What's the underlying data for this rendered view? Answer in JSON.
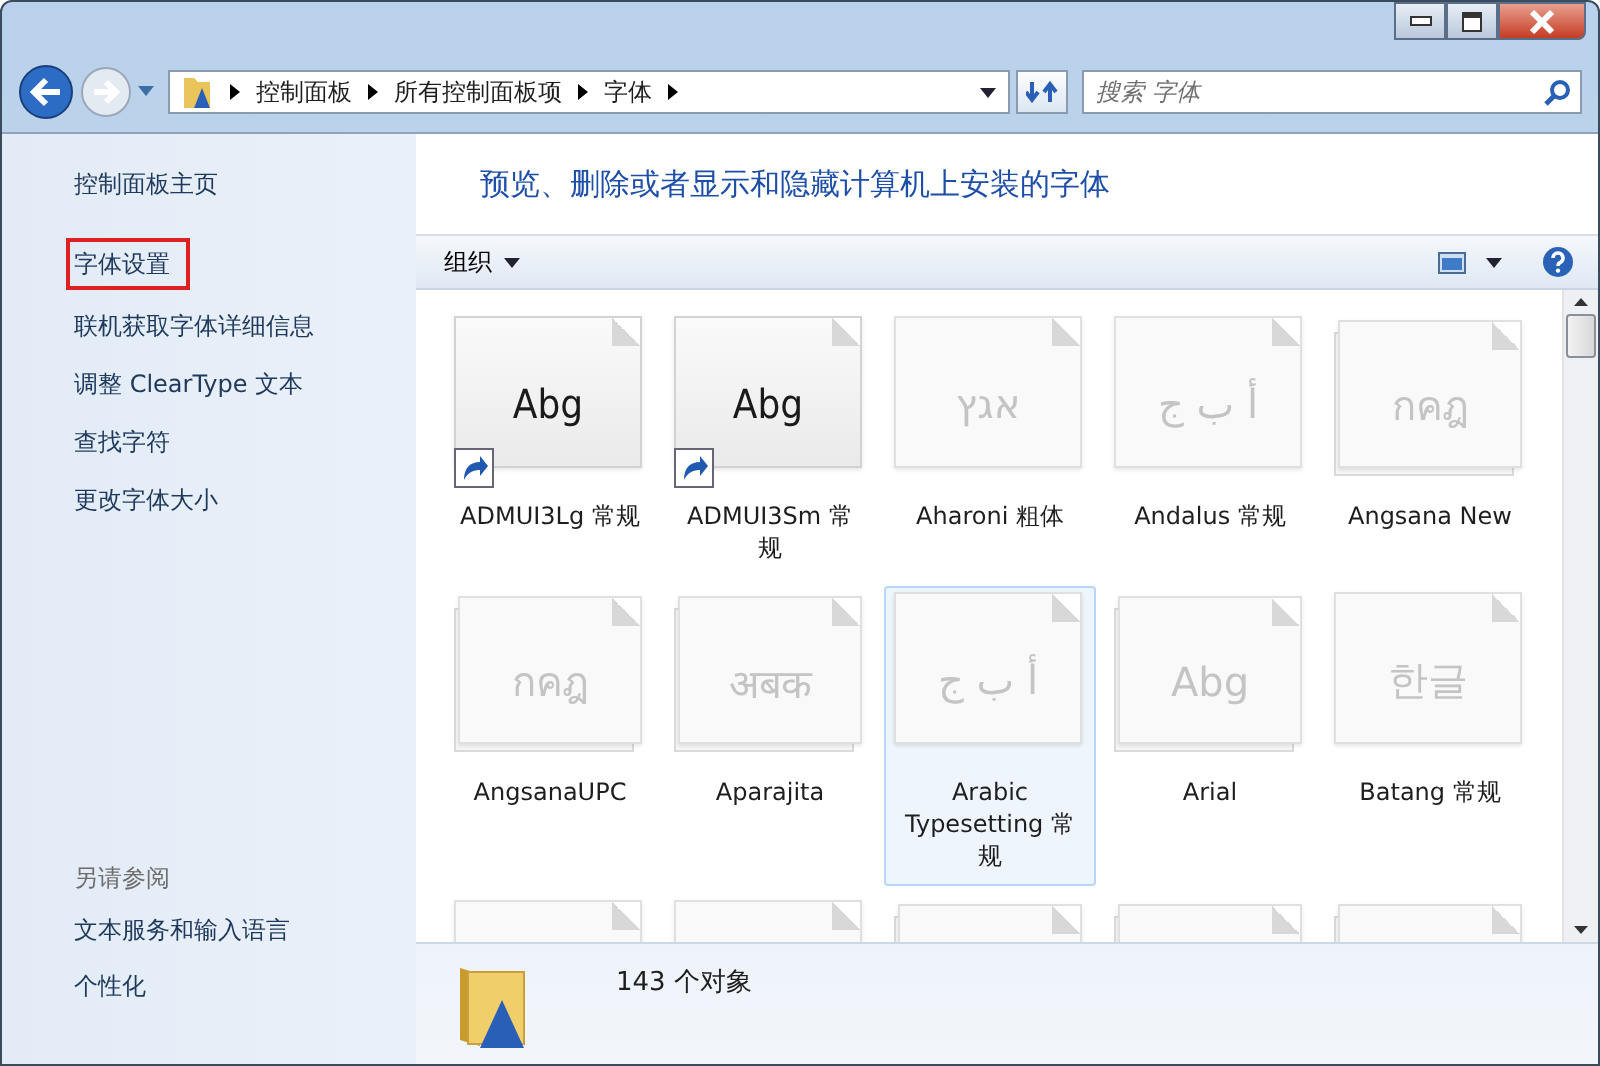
{
  "address_bar": {
    "crumbs": [
      "控制面板",
      "所有控制面板项",
      "字体"
    ]
  },
  "search": {
    "placeholder": "搜索 字体"
  },
  "sidebar": {
    "home": "控制面板主页",
    "items": [
      {
        "label": "字体设置",
        "selected": true
      },
      {
        "label": "联机获取字体详细信息",
        "selected": false
      },
      {
        "label": "调整 ClearType 文本",
        "selected": false
      },
      {
        "label": "查找字符",
        "selected": false
      },
      {
        "label": "更改字体大小",
        "selected": false
      }
    ],
    "see_also_title": "另请参阅",
    "see_also": [
      "文本服务和输入语言",
      "个性化"
    ]
  },
  "heading": "预览、删除或者显示和隐藏计算机上安装的字体",
  "toolbar": {
    "organize": "组织"
  },
  "fonts": [
    {
      "name": "ADMUI3Lg 常规",
      "preview": "Abg",
      "kind": "single",
      "hidden": false,
      "shortcut": true,
      "selected": false
    },
    {
      "name": "ADMUI3Sm 常规",
      "preview": "Abg",
      "kind": "single",
      "hidden": false,
      "shortcut": true,
      "selected": false
    },
    {
      "name": "Aharoni 粗体",
      "preview": "אגץ",
      "kind": "single",
      "hidden": true,
      "shortcut": false,
      "selected": false
    },
    {
      "name": "Andalus 常规",
      "preview": "أ ب ج",
      "kind": "single",
      "hidden": true,
      "shortcut": false,
      "selected": false
    },
    {
      "name": "Angsana New",
      "preview": "กคฎ",
      "kind": "stacked",
      "hidden": true,
      "shortcut": false,
      "selected": false
    },
    {
      "name": "AngsanaUPC",
      "preview": "กคฎ",
      "kind": "stacked",
      "hidden": true,
      "shortcut": false,
      "selected": false
    },
    {
      "name": "Aparajita",
      "preview": "अबक",
      "kind": "stacked",
      "hidden": true,
      "shortcut": false,
      "selected": false
    },
    {
      "name": "Arabic Typesetting 常规",
      "preview": "أ ب ج",
      "kind": "single",
      "hidden": true,
      "shortcut": false,
      "selected": true
    },
    {
      "name": "Arial",
      "preview": "Abg",
      "kind": "stacked",
      "hidden": true,
      "shortcut": false,
      "selected": false
    },
    {
      "name": "Batang 常规",
      "preview": "한글",
      "kind": "single",
      "hidden": true,
      "shortcut": false,
      "selected": false
    }
  ],
  "more_tiles": [
    {
      "kind": "single"
    },
    {
      "kind": "single"
    },
    {
      "kind": "stacked"
    },
    {
      "kind": "stacked"
    },
    {
      "kind": "stacked"
    }
  ],
  "details": {
    "count": "143 个对象"
  }
}
